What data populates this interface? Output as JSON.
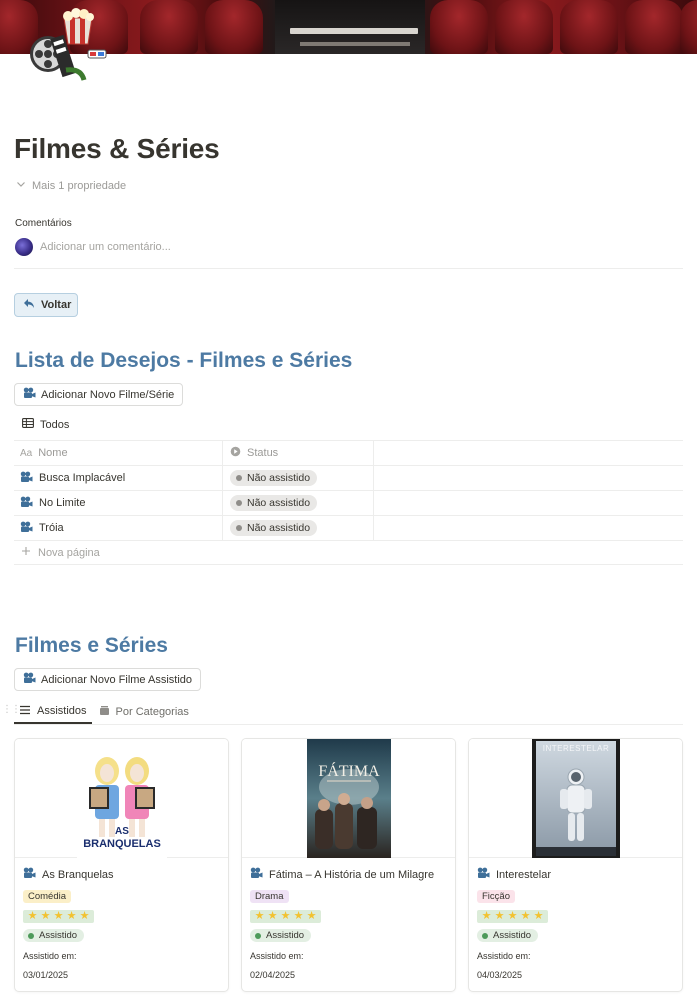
{
  "page": {
    "title": "Filmes & Séries",
    "more_properties": "Mais 1 propriedade",
    "comments_label": "Comentários",
    "comment_placeholder": "Adicionar um comentário..."
  },
  "back_button": {
    "label": "Voltar"
  },
  "wishlist": {
    "heading": "Lista de Desejos - Filmes e Séries",
    "add_button": "Adicionar Novo Filme/Série",
    "view_tab": "Todos",
    "columns": {
      "name": "Nome",
      "status": "Status"
    },
    "rows": [
      {
        "name": "Busca Implacável",
        "status": "Não assistido"
      },
      {
        "name": "No Limite",
        "status": "Não assistido"
      },
      {
        "name": "Tróia",
        "status": "Não assistido"
      }
    ],
    "new_page": "Nova página"
  },
  "watched": {
    "heading": "Filmes e Séries",
    "add_button": "Adicionar Novo Filme Assistido",
    "tabs": [
      {
        "label": "Assistidos",
        "icon": "list-icon",
        "active": true
      },
      {
        "label": "Por Categorias",
        "icon": "card-stack-icon",
        "active": false
      }
    ],
    "cards": [
      {
        "title": "As Branquelas",
        "genre": "Comédia",
        "genre_bg": "#fbefc8",
        "rating": 5,
        "status": "Assistido",
        "watched_label": "Assistido em:",
        "watched_date": "03/01/2025",
        "poster_text": "AS BRANQUELAS"
      },
      {
        "title": "Fátima – A História de um Milagre",
        "genre": "Drama",
        "genre_bg": "#efe2f5",
        "rating": 5,
        "status": "Assistido",
        "watched_label": "Assistido em:",
        "watched_date": "02/04/2025",
        "poster_text": "FÁTIMA"
      },
      {
        "title": "Interestelar",
        "genre": "Ficção",
        "genre_bg": "#fbe3ea",
        "rating": 5,
        "status": "Assistido",
        "watched_label": "Assistido em:",
        "watched_date": "04/03/2025",
        "poster_text": "INTERESTELAR"
      }
    ]
  },
  "colors": {
    "heading": "#4d7aa3",
    "accent_icon": "#3f6f99"
  }
}
